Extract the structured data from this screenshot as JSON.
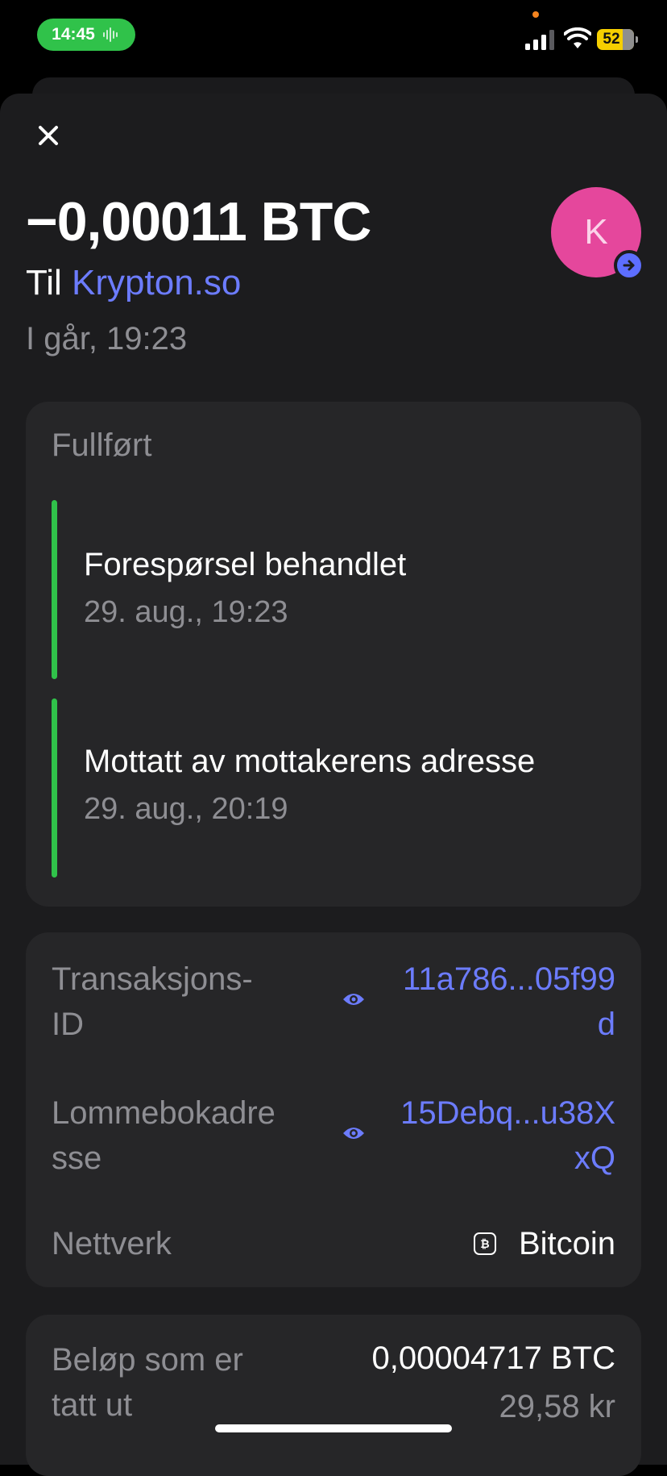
{
  "status_bar": {
    "time": "14:45",
    "battery": "52"
  },
  "transaction": {
    "amount": "−0,00011 BTC",
    "to_prefix": "Til ",
    "recipient": "Krypton.so",
    "date": "I går, 19:23",
    "avatar_letter": "K"
  },
  "status_card": {
    "title": "Fullført",
    "steps": [
      {
        "title": "Forespørsel behandlet",
        "time": "29. aug., 19:23"
      },
      {
        "title": "Mottatt av mottakerens adresse",
        "time": "29. aug., 20:19"
      }
    ]
  },
  "details": {
    "tx_id_label_1": "Transaksjons-",
    "tx_id_label_2": "ID",
    "tx_id_value_1": "11a786...05f99",
    "tx_id_value_2": "d",
    "wallet_label_1": "Lommebokadre",
    "wallet_label_2": "sse",
    "wallet_value_1": "15Debq...u38X",
    "wallet_value_2": "xQ",
    "network_label": "Nettverk",
    "network_value": "Bitcoin"
  },
  "amount_card": {
    "label_1": "Beløp som er",
    "label_2": "tatt ut",
    "btc_value": "0,00004717 BTC",
    "fiat_value": "29,58 kr"
  },
  "colors": {
    "accent": "#6c7cff",
    "success": "#30c24a",
    "avatar": "#e5479c"
  }
}
